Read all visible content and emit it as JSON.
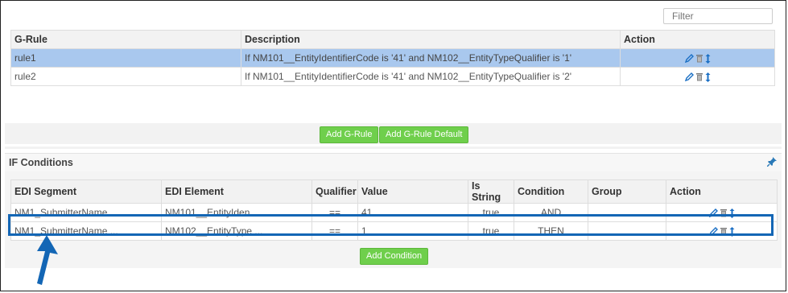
{
  "filter": {
    "placeholder": "Filter"
  },
  "grule_table": {
    "headers": {
      "rule": "G-Rule",
      "description": "Description",
      "action": "Action"
    },
    "rows": [
      {
        "rule": "rule1",
        "description": "If NM101__EntityIdentifierCode is '41' and NM102__EntityTypeQualifier is '1'",
        "selected": true
      },
      {
        "rule": "rule2",
        "description": "If NM101__EntityIdentifierCode is '41' and NM102__EntityTypeQualifier is '2'",
        "selected": false
      }
    ]
  },
  "buttons": {
    "add_grule": "Add G-Rule",
    "add_grule_default": "Add G-Rule Default",
    "add_condition": "Add Condition"
  },
  "if_conditions": {
    "title": "IF Conditions",
    "headers": {
      "segment": "EDI Segment",
      "element": "EDI Element",
      "qualifier": "Qualifier",
      "value": "Value",
      "is_string": "Is String",
      "condition": "Condition",
      "group": "Group",
      "action": "Action"
    },
    "rows": [
      {
        "segment": "NM1_SubmitterName ...",
        "element": "NM101__EntityIden ...",
        "qualifier": "==",
        "value": "41",
        "is_string": "true",
        "condition": "AND",
        "group": ""
      },
      {
        "segment": "NM1_SubmitterName ...",
        "element": "NM102__EntityType ...",
        "qualifier": "==",
        "value": "1",
        "is_string": "true",
        "condition": "THEN",
        "group": ""
      }
    ]
  },
  "colors": {
    "accent": "#1366b5",
    "button_green": "#6fcf4c",
    "selected_row": "#a9c8ee",
    "link": "#2a7ab8"
  }
}
